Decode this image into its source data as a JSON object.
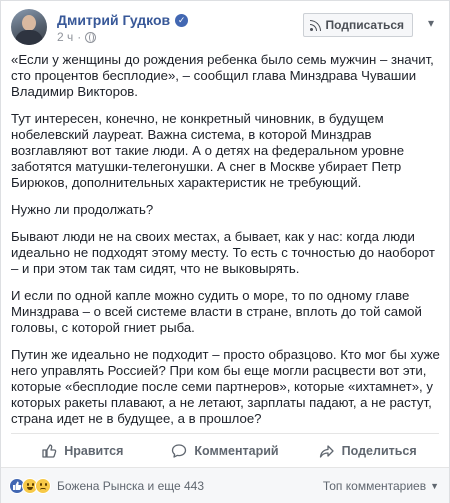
{
  "header": {
    "author_name": "Дмитрий Гудков",
    "timestamp": "2 ч",
    "follow_label": "Подписаться",
    "verified_icon": "verified-check-icon",
    "privacy_icon": "globe-icon",
    "menu_icon": "chevron-down-icon"
  },
  "post": {
    "paragraphs": [
      "«Если у женщины до рождения ребенка было семь мужчин – значит, сто процентов бесплодие», – сообщил глава Минздрава Чувашии Владимир Викторов.",
      "Тут интересен, конечно, не конкретный чиновник, в будущем нобелевский лауреат. Важна система, в которой Минздрав возглавляют вот такие люди. А о детях на федеральном уровне заботятся матушки-телегонушки. А снег в Москве убирает Петр Бирюков, дополнительных характеристик не требующий.",
      "Нужно ли продолжать?",
      "Бывают люди не на своих местах, а бывает, как у нас: когда люди идеально не подходят этому месту. То есть с точностью до наоборот – и при этом так там сидят, что не выковырять.",
      "И если по одной капле можно судить о море, то по одному главе Минздрава – о всей системе власти в стране, вплоть до той самой головы, с которой гниет рыба.",
      "Путин же идеально не подходит – просто образцово. Кто мог бы хуже него управлять Россией? При ком бы еще могли расцвести вот эти, которые «бесплодие после семи партнеров», которые «ихтамнет», у которых ракеты плавают, а не летают, зарплаты падают, а не растут, страна идет не в будущее, а в прошлое?"
    ]
  },
  "actions": {
    "like_label": "Нравится",
    "comment_label": "Комментарий",
    "share_label": "Поделиться"
  },
  "reactions": {
    "summary": "Божена Рынска и еще 443",
    "top_comments_label": "Топ комментариев",
    "icons": [
      "like-reaction-icon",
      "haha-reaction-icon",
      "sad-reaction-icon"
    ]
  },
  "colors": {
    "link": "#385898",
    "text": "#1d2129",
    "muted": "#90949c",
    "accent": "#4267b2"
  }
}
